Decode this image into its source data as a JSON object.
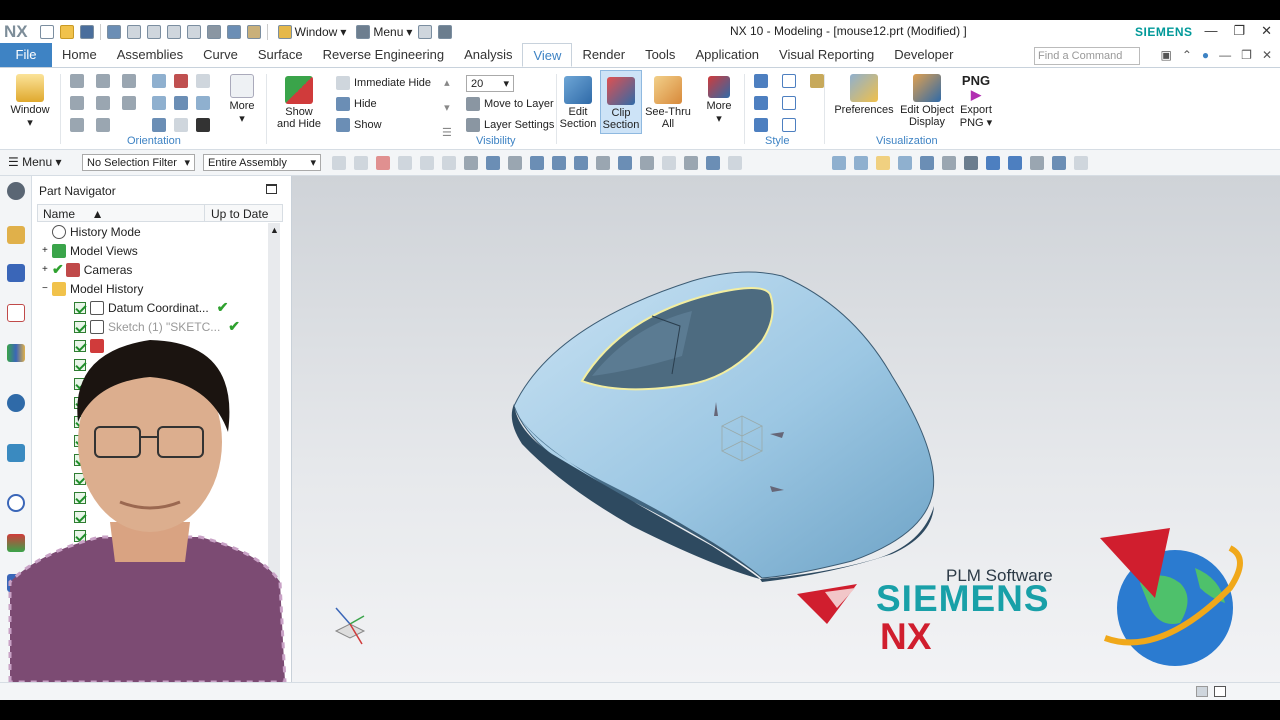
{
  "titlebar": {
    "logo": "NX",
    "window_menu": "Window",
    "menu_menu": "Menu",
    "title": "NX 10 - Modeling - [mouse12.prt (Modified) ]",
    "brand": "SIEMENS"
  },
  "tabs": [
    "File",
    "Home",
    "Assemblies",
    "Curve",
    "Surface",
    "Reverse Engineering",
    "Analysis",
    "View",
    "Render",
    "Tools",
    "Application",
    "Visual Reporting",
    "Developer"
  ],
  "active_tab": "View",
  "search": {
    "placeholder": "Find a Command"
  },
  "ribbon": {
    "window_label": "Window",
    "orientation_label": "Orientation",
    "more_label": "More",
    "show_hide_label_1": "Show",
    "show_hide_label_2": "and Hide",
    "immediate_hide": "Immediate Hide",
    "hide": "Hide",
    "show": "Show",
    "layer_value": "20",
    "move_to_layer": "Move to Layer",
    "layer_settings": "Layer Settings",
    "visibility_label": "Visibility",
    "edit_section_1": "Edit",
    "edit_section_2": "Section",
    "clip_section_1": "Clip",
    "clip_section_2": "Section",
    "see_thru_1": "See-Thru",
    "see_thru_2": "All",
    "more2": "More",
    "style_label": "Style",
    "preferences": "Preferences",
    "edit_object_1": "Edit Object",
    "edit_object_2": "Display",
    "export_1": "Export",
    "export_2": "PNG",
    "png": "PNG",
    "visualization_label": "Visualization"
  },
  "selection": {
    "menu": "Menu",
    "filter": "No Selection Filter",
    "scope": "Entire Assembly"
  },
  "navigator": {
    "title": "Part Navigator",
    "col_name": "Name",
    "col_uptodate": "Up to Date",
    "items": [
      {
        "label": "History Mode"
      },
      {
        "label": "Model Views"
      },
      {
        "label": "Cameras"
      },
      {
        "label": "Model History"
      },
      {
        "label": "Datum Coordinat..."
      },
      {
        "label": "Sketch (1) \"SKETC..."
      }
    ]
  },
  "branding": {
    "plm": "PLM Software",
    "siemens": "SIEMENS",
    "nx": "NX"
  },
  "colors": {
    "accent": "#3e83c4",
    "model": "#a9cfe6",
    "siemens_teal": "#19a0a8",
    "nx_red": "#d01e2e"
  }
}
